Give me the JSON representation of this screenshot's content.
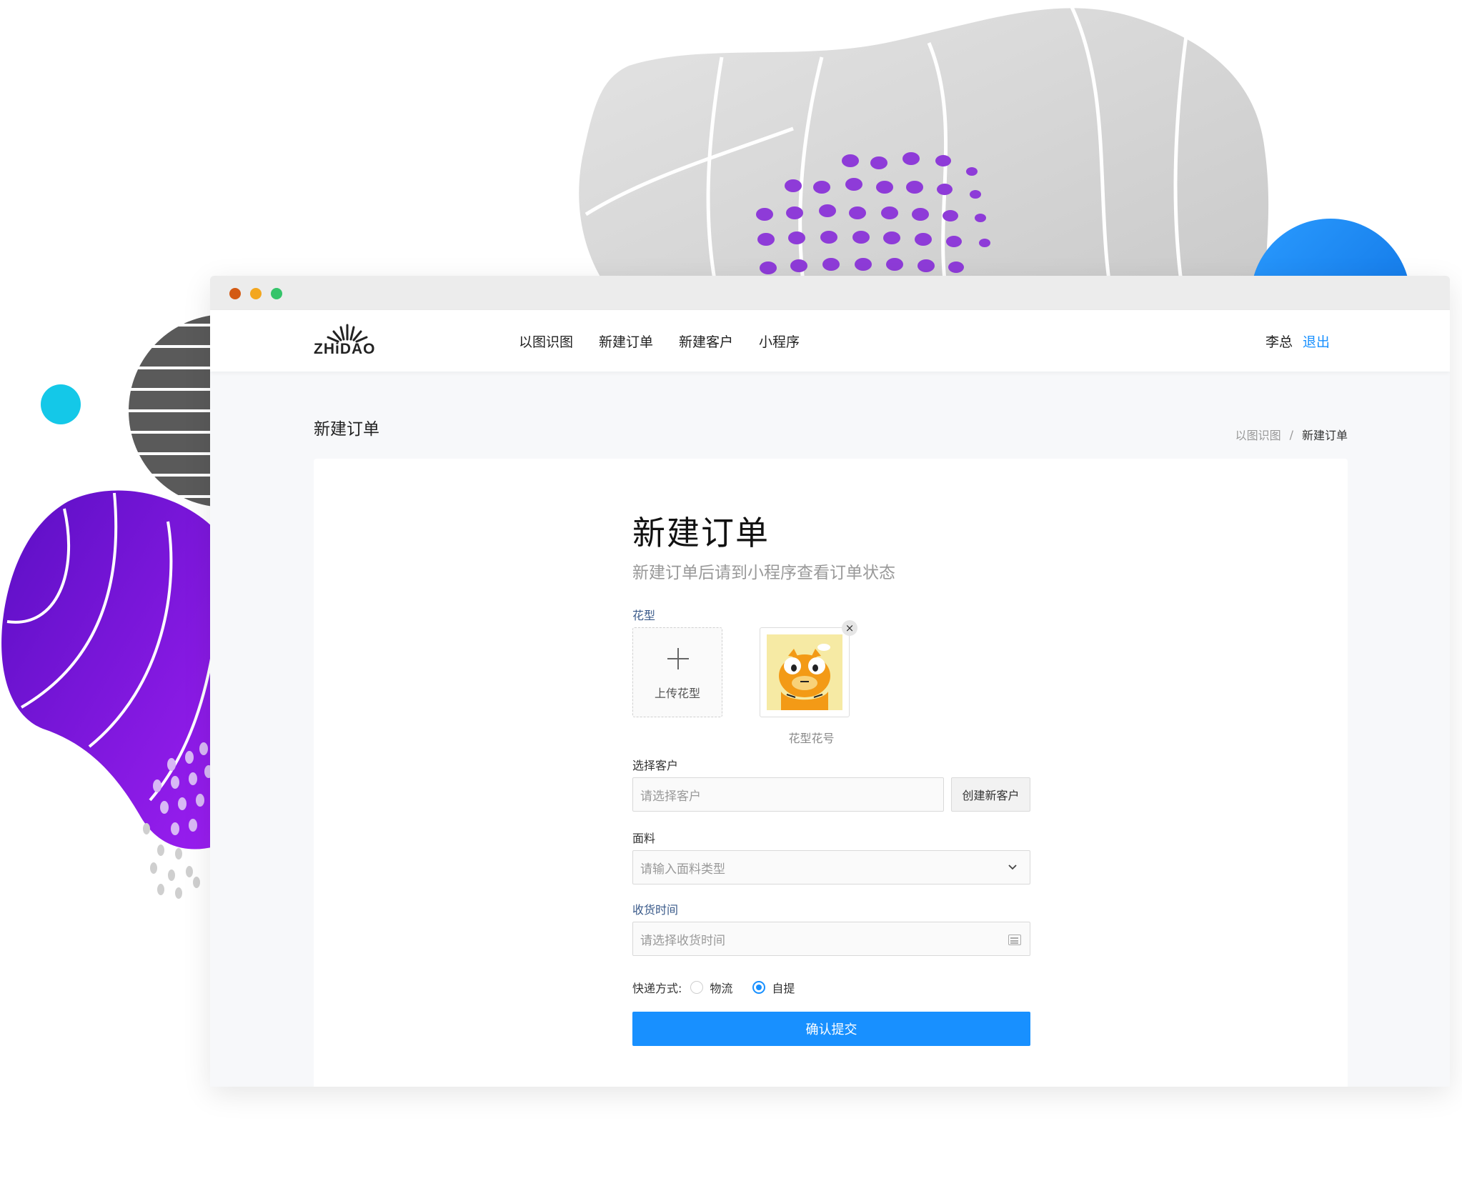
{
  "window": {
    "controls": [
      "close",
      "minimize",
      "maximize"
    ]
  },
  "brand": {
    "logo_text": "ZHiDAO"
  },
  "nav": {
    "items": [
      {
        "label": "以图识图"
      },
      {
        "label": "新建订单"
      },
      {
        "label": "新建客户"
      },
      {
        "label": "小程序"
      }
    ]
  },
  "user": {
    "name": "李总",
    "logout_label": "退出"
  },
  "page": {
    "title": "新建订单",
    "breadcrumb": [
      "以图识图",
      "新建订单"
    ],
    "breadcrumb_separator": "/"
  },
  "form": {
    "heading": "新建订单",
    "subheading": "新建订单后请到小程序查看订单状态",
    "pattern": {
      "label": "花型",
      "upload_label": "上传花型",
      "thumbnail_caption": "花型花号",
      "remove_icon": "×"
    },
    "customer": {
      "label": "选择客户",
      "placeholder": "请选择客户",
      "create_button": "创建新客户"
    },
    "fabric": {
      "label": "面料",
      "placeholder": "请输入面料类型"
    },
    "delivery_time": {
      "label": "收货时间",
      "placeholder": "请选择收货时间"
    },
    "shipping": {
      "label": "快递方式:",
      "options": [
        {
          "label": "物流",
          "checked": false
        },
        {
          "label": "自提",
          "checked": true
        }
      ]
    },
    "submit_label": "确认提交"
  },
  "colors": {
    "accent": "#1890ff",
    "purple_blob": "#7a12d8",
    "blue_dot": "#1d8df0",
    "cyan_dot": "#14c8e8"
  }
}
